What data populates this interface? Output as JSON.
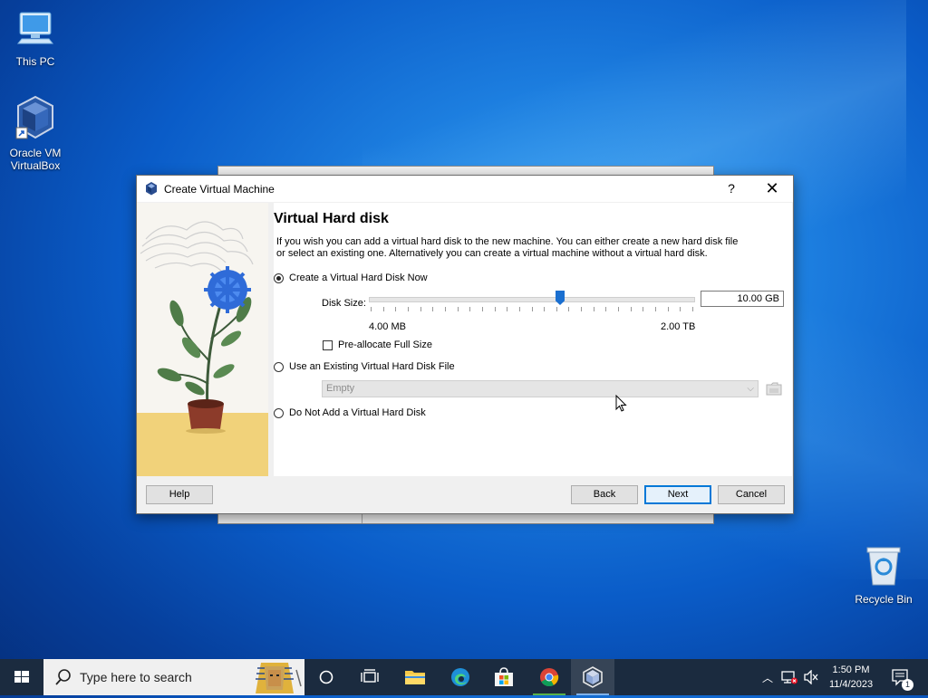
{
  "desktop": {
    "icons": [
      {
        "label": "This PC"
      },
      {
        "label_line1": "Oracle VM",
        "label_line2": "VirtualBox"
      },
      {
        "label": "Recycle Bin"
      }
    ]
  },
  "dialog": {
    "title": "Create Virtual Machine",
    "help_glyph": "?",
    "close_glyph": "✕",
    "heading": "Virtual Hard disk",
    "description": "If you wish you can add a virtual hard disk to the new machine. You can either create a new hard disk file or select an existing one. Alternatively you can create a virtual machine without a virtual hard disk.",
    "options": {
      "create_new": {
        "label": "Create a Virtual Hard Disk Now",
        "selected": true
      },
      "use_existing": {
        "label": "Use an Existing Virtual Hard Disk File",
        "selected": false
      },
      "none": {
        "label": "Do Not Add a Virtual Hard Disk",
        "selected": false
      }
    },
    "disk_size": {
      "label": "Disk Size:",
      "value": "10.00 GB",
      "min_label": "4.00 MB",
      "max_label": "2.00 TB",
      "slider_fraction": 0.59
    },
    "preallocate": {
      "label": "Pre-allocate Full Size",
      "checked": false
    },
    "existing_file_combo": {
      "value": "Empty"
    },
    "buttons": {
      "help": "Help",
      "back": "Back",
      "next": "Next",
      "cancel": "Cancel"
    }
  },
  "taskbar": {
    "search_placeholder": "Type here to search",
    "clock_time": "1:50 PM",
    "clock_date": "11/4/2023",
    "notification_count": "1"
  },
  "colors": {
    "accent": "#0078d7",
    "slider_thumb": "#1a6fd0",
    "taskbar_bg": "#1b2b3f"
  }
}
